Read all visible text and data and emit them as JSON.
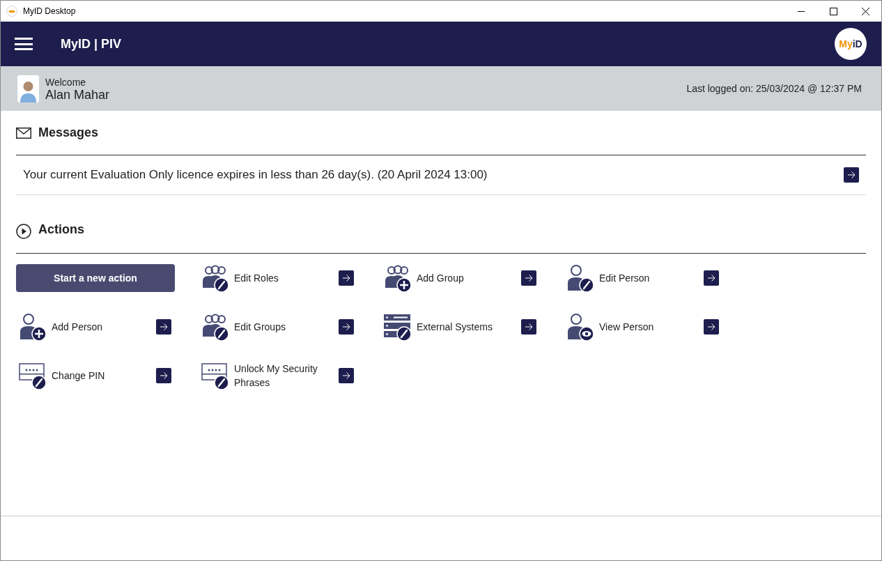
{
  "window": {
    "title": "MyID Desktop"
  },
  "header": {
    "title": "MyID | PIV",
    "logo": "MyiD"
  },
  "user": {
    "greeting": "Welcome",
    "name": "Alan Mahar",
    "last_logged": "Last logged on: 25/03/2024 @ 12:37 PM"
  },
  "messages": {
    "heading": "Messages",
    "items": [
      {
        "text": "Your current Evaluation Only licence expires in less than 26 day(s). (20 April 2024 13:00)"
      }
    ]
  },
  "actions": {
    "heading": "Actions",
    "start_button": "Start a new action",
    "items": [
      {
        "label": "Edit Roles"
      },
      {
        "label": "Add Group"
      },
      {
        "label": "Edit Person"
      },
      {
        "label": "Add Person"
      },
      {
        "label": "Edit Groups"
      },
      {
        "label": "External Systems"
      },
      {
        "label": "View Person"
      },
      {
        "label": "Change PIN"
      },
      {
        "label": "Unlock My Security Phrases"
      }
    ]
  }
}
